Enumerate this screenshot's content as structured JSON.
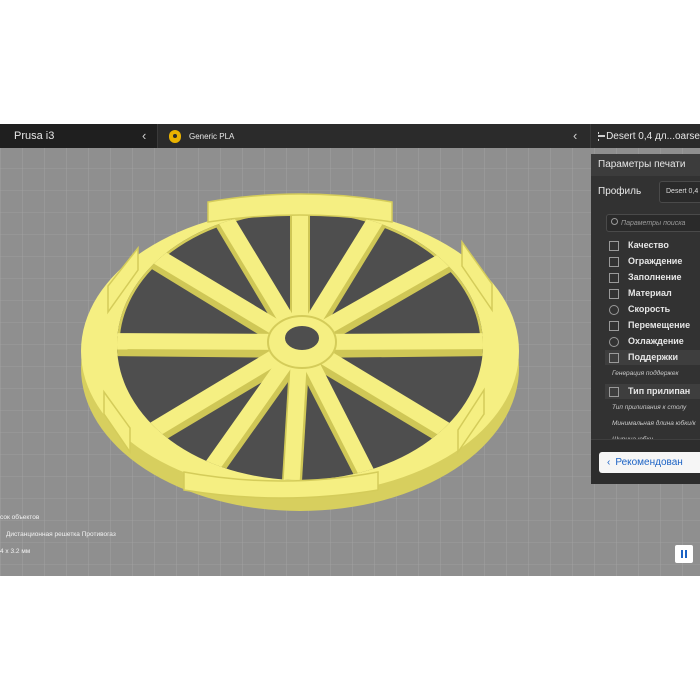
{
  "topbar": {
    "printer": "Prusa i3",
    "material": "Generic PLA",
    "profile": "Desert 0,4 дл...oarse"
  },
  "icons": {
    "printer_chevron": "chevron-left-icon",
    "material_chevron": "chevron-left-icon",
    "material": "spool-location-icon",
    "profile": "settings-sliders-icon"
  },
  "panel": {
    "title": "Параметры печати",
    "profile_label": "Профиль",
    "profile_value": "Desert 0,4",
    "search_placeholder": "Параметры поиска",
    "categories": [
      {
        "label": "Качество",
        "icon": "quality-icon"
      },
      {
        "label": "Ограждение",
        "icon": "shell-icon"
      },
      {
        "label": "Заполнение",
        "icon": "infill-icon"
      },
      {
        "label": "Материал",
        "icon": "material-icon"
      },
      {
        "label": "Скорость",
        "icon": "speed-icon"
      },
      {
        "label": "Перемещение",
        "icon": "travel-icon"
      },
      {
        "label": "Охлаждение",
        "icon": "cooling-icon"
      },
      {
        "label": "Поддержки",
        "icon": "support-icon"
      }
    ],
    "support_setting": "Генерация поддержек",
    "adhesion_category": {
      "label": "Тип прилипан",
      "icon": "adhesion-icon"
    },
    "adhesion_settings": [
      "Тип прилипания к столу",
      "Минимальная длина юбки/к",
      "Ширина юбки"
    ],
    "recommended_button": "Рекомендован"
  },
  "object_info": {
    "list_label": "сок объектов",
    "object_name": "Дистанционная решетка Противогаз",
    "dimensions": "4 x 3.2 мм"
  },
  "colors": {
    "model": "#f4ee7c",
    "model_shade": "#d9d15c",
    "build_plate": "#8f8f8f",
    "panel_bg": "#323232",
    "accent": "#1c63c5"
  }
}
